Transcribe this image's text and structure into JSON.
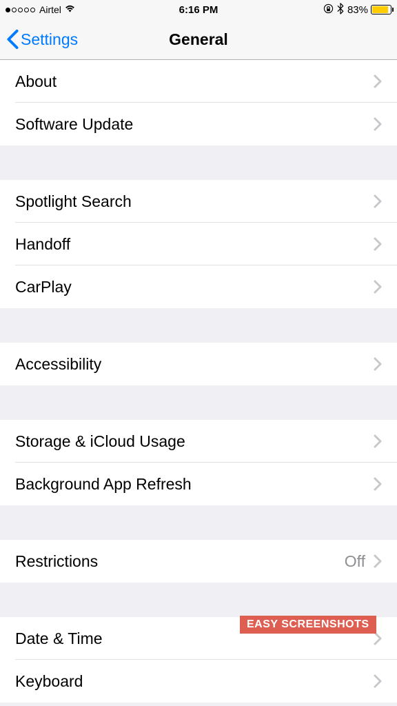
{
  "status": {
    "carrier": "Airtel",
    "time": "6:16 PM",
    "battery_percent": "83%"
  },
  "nav": {
    "back_label": "Settings",
    "title": "General"
  },
  "groups": [
    {
      "rows": [
        {
          "label": "About"
        },
        {
          "label": "Software Update"
        }
      ]
    },
    {
      "rows": [
        {
          "label": "Spotlight Search"
        },
        {
          "label": "Handoff"
        },
        {
          "label": "CarPlay"
        }
      ]
    },
    {
      "rows": [
        {
          "label": "Accessibility"
        }
      ]
    },
    {
      "rows": [
        {
          "label": "Storage & iCloud Usage"
        },
        {
          "label": "Background App Refresh"
        }
      ]
    },
    {
      "rows": [
        {
          "label": "Restrictions",
          "value": "Off"
        }
      ]
    },
    {
      "rows": [
        {
          "label": "Date & Time"
        },
        {
          "label": "Keyboard"
        }
      ]
    }
  ],
  "watermark": "EASY SCREENSHOTS"
}
